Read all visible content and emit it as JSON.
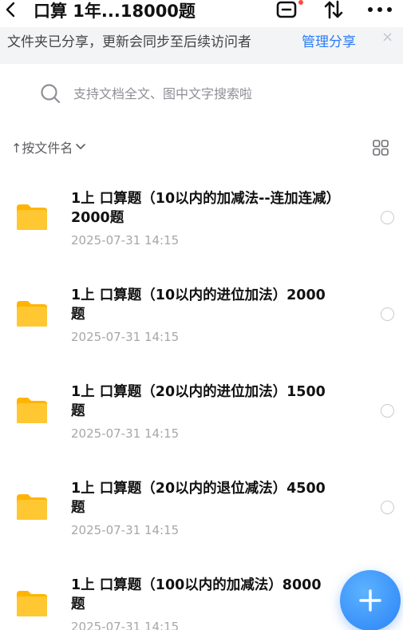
{
  "header": {
    "title": "口算 1年...18000题",
    "back_icon": "chevron-left-icon",
    "save_icon": "save-icon",
    "sort_icon": "transfer-arrows-icon",
    "more_icon": "more-dots-icon"
  },
  "banner": {
    "text": "文件夹已分享，更新会同步至后续访问者",
    "link_label": "管理分享",
    "close_label": "×",
    "link_color": "#2a7cf7"
  },
  "search": {
    "placeholder": "支持文档全文、图中文字搜索啦",
    "value": ""
  },
  "sort_bar": {
    "label": "↑按文件名",
    "view_icon": "grid-view-icon"
  },
  "files": [
    {
      "name": "1上 口算题（10以内的加减法--连加连减）2000题",
      "date": "2025-07-31 14:15"
    },
    {
      "name": "1上 口算题（10以内的进位加法）2000题",
      "date": "2025-07-31 14:15"
    },
    {
      "name": "1上 口算题（20以内的进位加法）1500题",
      "date": "2025-07-31 14:15"
    },
    {
      "name": "1上 口算题（20以内的退位减法）4500题",
      "date": "2025-07-31 14:15"
    },
    {
      "name": "1上 口算题（100以内的加减法）8000题",
      "date": "2025-07-31 14:15"
    }
  ],
  "fab": {
    "icon": "plus-icon",
    "color": "#2a82f6"
  },
  "colors": {
    "folder": "#ffc21f",
    "accent": "#2a7cf7",
    "banner_bg": "#f3f4f6"
  }
}
